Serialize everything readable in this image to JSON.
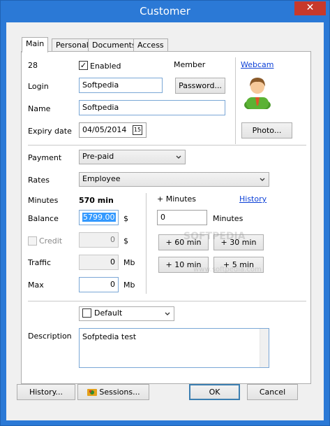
{
  "window": {
    "title": "Customer",
    "close_glyph": "✕"
  },
  "tabs": [
    {
      "label": "Main",
      "active": true
    },
    {
      "label": "Personal",
      "active": false
    },
    {
      "label": "Documents",
      "active": false
    },
    {
      "label": "Access",
      "active": false
    }
  ],
  "main": {
    "id": "28",
    "enabled_label": "Enabled",
    "enabled_checked": true,
    "member_label": "Member",
    "webcam_link": "Webcam",
    "login_label": "Login",
    "login_value": "Softpedia",
    "password_button": "Password...",
    "name_label": "Name",
    "name_value": "Softpedia",
    "expiry_label": "Expiry date",
    "expiry_value": "04/05/2014",
    "expiry_icon": "15",
    "photo_button": "Photo...",
    "avatar_icon": "user-avatar-icon"
  },
  "billing": {
    "payment_label": "Payment",
    "payment_value": "Pre-paid",
    "rates_label": "Rates",
    "rates_value": "Employee",
    "minutes_label": "Minutes",
    "minutes_value": "570 min",
    "balance_label": "Balance",
    "balance_value": "5799.00",
    "balance_unit": "$",
    "credit_label": "Credit",
    "credit_value": "0",
    "credit_unit": "$",
    "traffic_label": "Traffic",
    "traffic_value": "0",
    "traffic_unit": "Mb",
    "max_label": "Max",
    "max_value": "0",
    "max_unit": "Mb"
  },
  "add_minutes": {
    "label": "+ Minutes",
    "history_link": "History",
    "value": "0",
    "unit": "Minutes",
    "btn_60": "+ 60 min",
    "btn_30": "+ 30 min",
    "btn_10": "+ 10 min",
    "btn_5": "+ 5 min"
  },
  "misc": {
    "default_value": "Default",
    "description_label": "Description",
    "description_value": "Sofptedia test"
  },
  "footer": {
    "history_button": "History...",
    "sessions_button": "Sessions...",
    "ok_button": "OK",
    "cancel_button": "Cancel"
  },
  "watermark": {
    "line1": "SOFTPEDIA",
    "line2": "www.softpedia.com"
  },
  "colors": {
    "title_bar": "#2b79d6",
    "close_button": "#c7392b",
    "link": "#0b3fd6",
    "selection": "#3399ff"
  }
}
